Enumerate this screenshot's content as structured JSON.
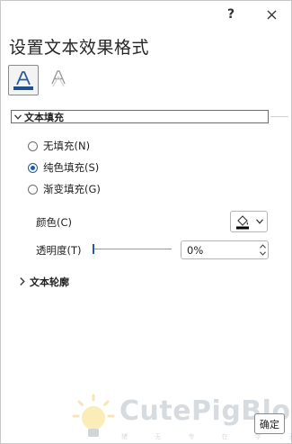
{
  "titlebar": {
    "help_label": "?"
  },
  "pane": {
    "title": "设置文本效果格式"
  },
  "tabs": [
    {
      "name": "text-fill-outline",
      "icon": "text-fill-outline-icon",
      "active": true
    },
    {
      "name": "text-effects",
      "icon": "text-effects-icon",
      "active": false
    }
  ],
  "sections": {
    "fill": {
      "title": "文本填充",
      "expanded": true,
      "options": [
        {
          "label": "无填充(N)",
          "checked": false
        },
        {
          "label": "纯色填充(S)",
          "checked": true
        },
        {
          "label": "渐变填充(G)",
          "checked": false
        }
      ],
      "color_label": "颜色(C)",
      "color_value": "#000000",
      "transparency_label": "透明度(T)",
      "transparency_value": "0%",
      "transparency_fraction": 0
    },
    "outline": {
      "title": "文本轮廓",
      "expanded": false
    }
  },
  "watermark": {
    "text": "CutePigBlog",
    "subtitle": "猪 无 专 在 学 无 止 境"
  },
  "footer": {
    "ok_label": "确定"
  },
  "colors": {
    "accent": "#1e5aa8",
    "border": "#c8c8c8"
  }
}
